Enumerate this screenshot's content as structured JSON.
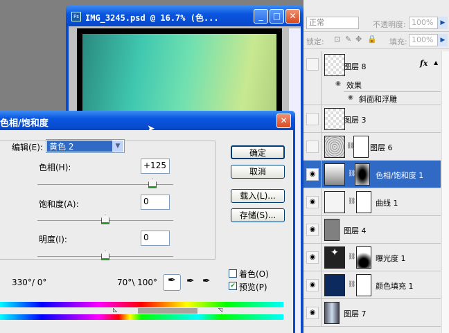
{
  "document": {
    "title": "IMG_3245.psd @ 16.7% (色...",
    "app_icon": "Ps"
  },
  "layers_panel": {
    "blend_mode": "正常",
    "opacity_label": "不透明度:",
    "opacity": "100%",
    "lock_label": "锁定:",
    "fill_label": "填充:",
    "fill": "100%",
    "layers": [
      {
        "name": "图层 8",
        "visible": false,
        "fx": "fx",
        "effects_label": "效果",
        "effect": "斜面和浮雕"
      },
      {
        "name": "图层 3",
        "visible": false
      },
      {
        "name": "图层 6",
        "visible": false
      },
      {
        "name": "色相/饱和度 1",
        "visible": true,
        "selected": true
      },
      {
        "name": "曲线 1",
        "visible": true
      },
      {
        "name": "图层 4",
        "visible": true
      },
      {
        "name": "曝光度 1",
        "visible": true
      },
      {
        "name": "颜色填充 1",
        "visible": true,
        "color": "#0d2a5e"
      },
      {
        "name": "图层 7",
        "visible": true
      }
    ]
  },
  "dialog": {
    "title": "色相/饱和度",
    "edit_label": "编辑(E):",
    "edit_value": "黄色 2",
    "hue_label": "色相(H):",
    "hue": "+125",
    "hue_value": 125,
    "saturation_label": "饱和度(A):",
    "saturation": "0",
    "saturation_value": 0,
    "lightness_label": "明度(I):",
    "lightness": "0",
    "lightness_value": 0,
    "ok": "确定",
    "cancel": "取消",
    "load": "载入(L)...",
    "save": "存储(S)...",
    "colorize_label": "着色(O)",
    "colorize": false,
    "preview_label": "预览(P)",
    "preview": true,
    "range_left": "330°/ 0°",
    "range_right": "70°\\ 100°"
  }
}
